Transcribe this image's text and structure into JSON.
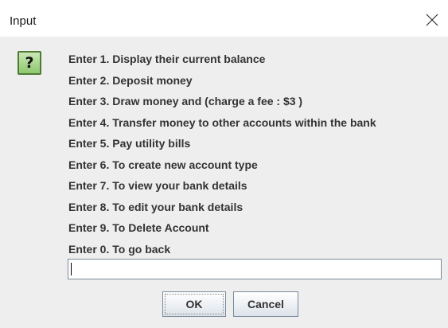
{
  "window": {
    "title": "Input",
    "close_icon": "close-icon"
  },
  "dialog": {
    "icon": "question-icon",
    "icon_glyph": "?",
    "icon_colors": {
      "fill_top": "#c9e6b4",
      "fill_bottom": "#8fc86f",
      "border": "#4d7b34"
    },
    "message_lines": [
      "Enter 1. Display their current balance",
      "Enter 2. Deposit money",
      "Enter 3. Draw money and (charge a fee : $3 )",
      "Enter 4. Transfer money to other accounts within the bank",
      "Enter 5. Pay utility bills",
      "Enter 6. To create new account type",
      "Enter 7. To view your bank details",
      "Enter 8. To edit your bank details",
      "Enter 9. To Delete Account",
      "Enter 0. To go back"
    ],
    "input_value": "",
    "buttons": {
      "ok_label": "OK",
      "cancel_label": "Cancel"
    }
  },
  "colors": {
    "title_bar_bg": "#ffffff",
    "content_bg": "#eeeeee",
    "text": "#333333",
    "input_border": "#7a8a99"
  }
}
